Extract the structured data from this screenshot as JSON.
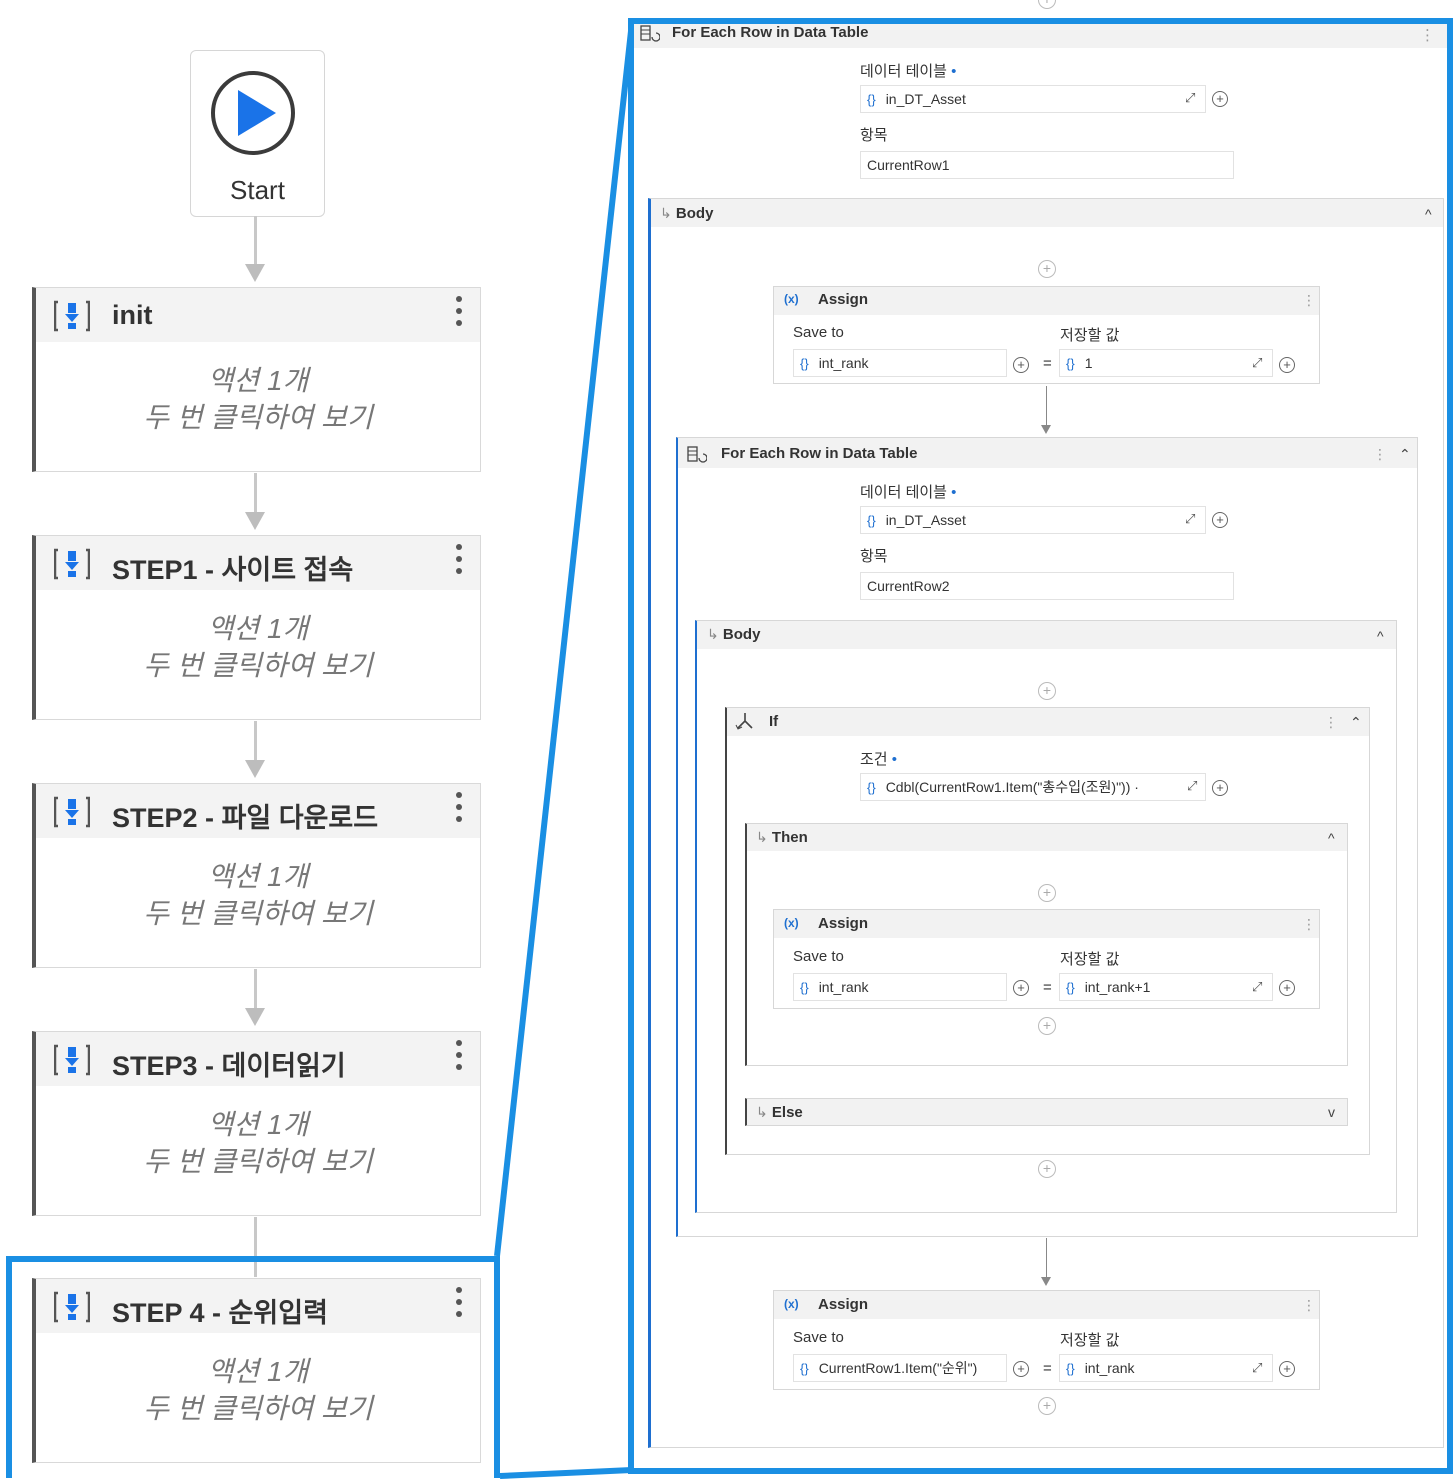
{
  "flow": {
    "start_label": "Start",
    "sequences": [
      {
        "title": "init",
        "line1": "액션 1개",
        "line2": "두 번 클릭하여 보기"
      },
      {
        "title": "STEP1 - 사이트 접속",
        "line1": "액션 1개",
        "line2": "두 번 클릭하여 보기"
      },
      {
        "title": "STEP2 - 파일 다운로드",
        "line1": "액션 1개",
        "line2": "두 번 클릭하여 보기"
      },
      {
        "title": "STEP3 - 데이터읽기",
        "line1": "액션 1개",
        "line2": "두 번 클릭하여 보기"
      },
      {
        "title": "STEP 4 - 순위입력",
        "line1": "액션 1개",
        "line2": "두 번 클릭하여 보기"
      }
    ]
  },
  "outer_loop": {
    "title": "For Each Row in Data Table",
    "table_label": "데이터 테이블",
    "table_value": "in_DT_Asset",
    "item_label": "항목",
    "item_value": "CurrentRow1",
    "body_label": "Body"
  },
  "assign1": {
    "title": "Assign",
    "save_label": "Save to",
    "value_label": "저장할 값",
    "save_value": "int_rank",
    "value": "1"
  },
  "inner_loop": {
    "title": "For Each Row in Data Table",
    "table_label": "데이터 테이블",
    "table_value": "in_DT_Asset",
    "item_label": "항목",
    "item_value": "CurrentRow2",
    "body_label": "Body"
  },
  "if_block": {
    "title": "If",
    "cond_label": "조건",
    "cond_value": "Cdbl(CurrentRow1.Item(\"총수입(조원)\")) ·",
    "then_label": "Then",
    "else_label": "Else"
  },
  "assign2": {
    "title": "Assign",
    "save_label": "Save to",
    "value_label": "저장할 값",
    "save_value": "int_rank",
    "value": "int_rank+1"
  },
  "assign3": {
    "title": "Assign",
    "save_label": "Save to",
    "value_label": "저장할 값",
    "save_value": "CurrentRow1.Item(\"순위\")",
    "value": "int_rank"
  },
  "glyphs": {
    "required": "•",
    "brace": "{}",
    "plus": "+",
    "eq": "=",
    "expand": "⤢",
    "body_arrow": "↳",
    "x_icon": "(x)",
    "chev_up": "^",
    "chev_down": "v",
    "dbl_up": "⌃",
    "menu": "⋮"
  },
  "colors": {
    "accent": "#1a8fe3",
    "brace": "#1e6fd0",
    "play": "#1a73e8"
  }
}
